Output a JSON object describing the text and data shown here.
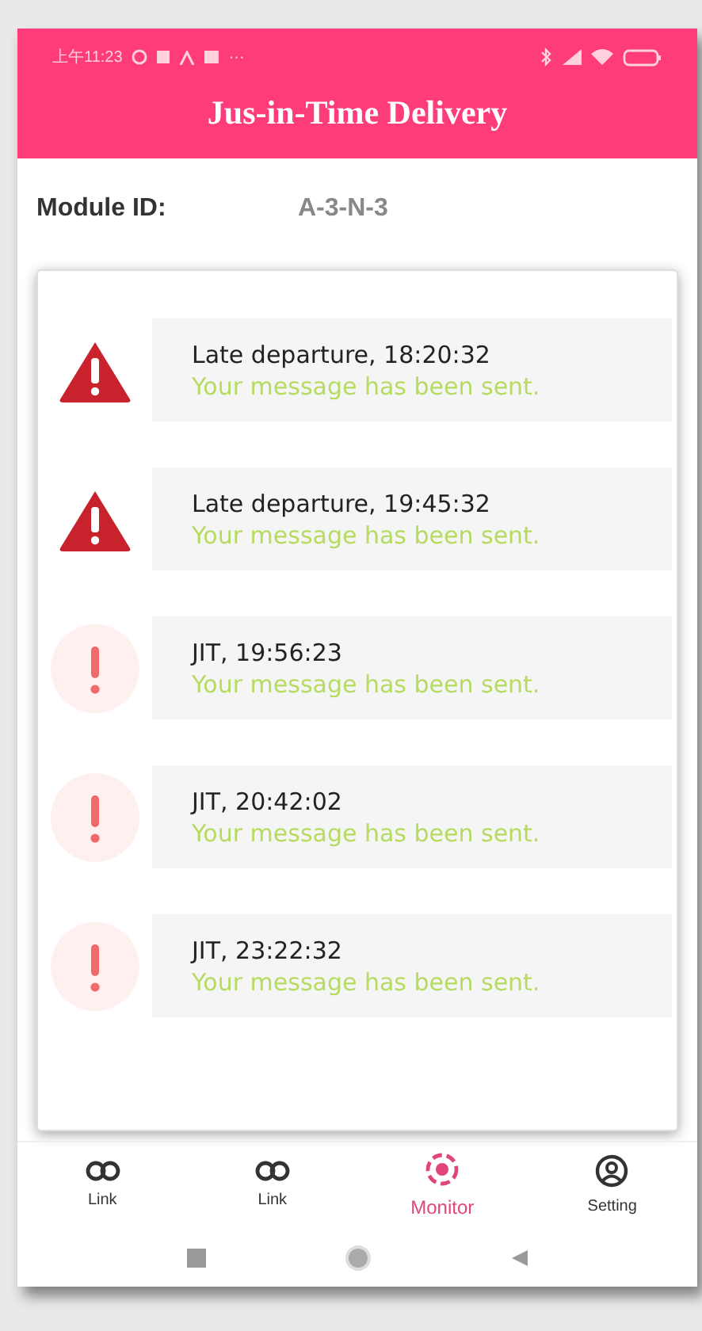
{
  "status_bar": {
    "time": "上午11:23",
    "more": "···"
  },
  "header": {
    "title": "Jus-in-Time Delivery"
  },
  "module": {
    "label": "Module ID:",
    "value": "A-3-N-3"
  },
  "messages": [
    {
      "kind": "warning",
      "title": "Late departure, 18:20:32",
      "status": "Your message has been sent."
    },
    {
      "kind": "warning",
      "title": "Late departure, 19:45:32",
      "status": "Your message has been sent."
    },
    {
      "kind": "alert",
      "title": "JIT, 19:56:23",
      "status": "Your message has been sent."
    },
    {
      "kind": "alert",
      "title": "JIT, 20:42:02",
      "status": "Your message has been sent."
    },
    {
      "kind": "alert",
      "title": "JIT, 23:22:32",
      "status": "Your message has been sent."
    }
  ],
  "nav": [
    {
      "kind": "link",
      "label": "Link",
      "selected": false
    },
    {
      "kind": "link",
      "label": "Link",
      "selected": false
    },
    {
      "kind": "monitor",
      "label": "Monitor",
      "selected": true
    },
    {
      "kind": "setting",
      "label": "Setting",
      "selected": false
    }
  ]
}
